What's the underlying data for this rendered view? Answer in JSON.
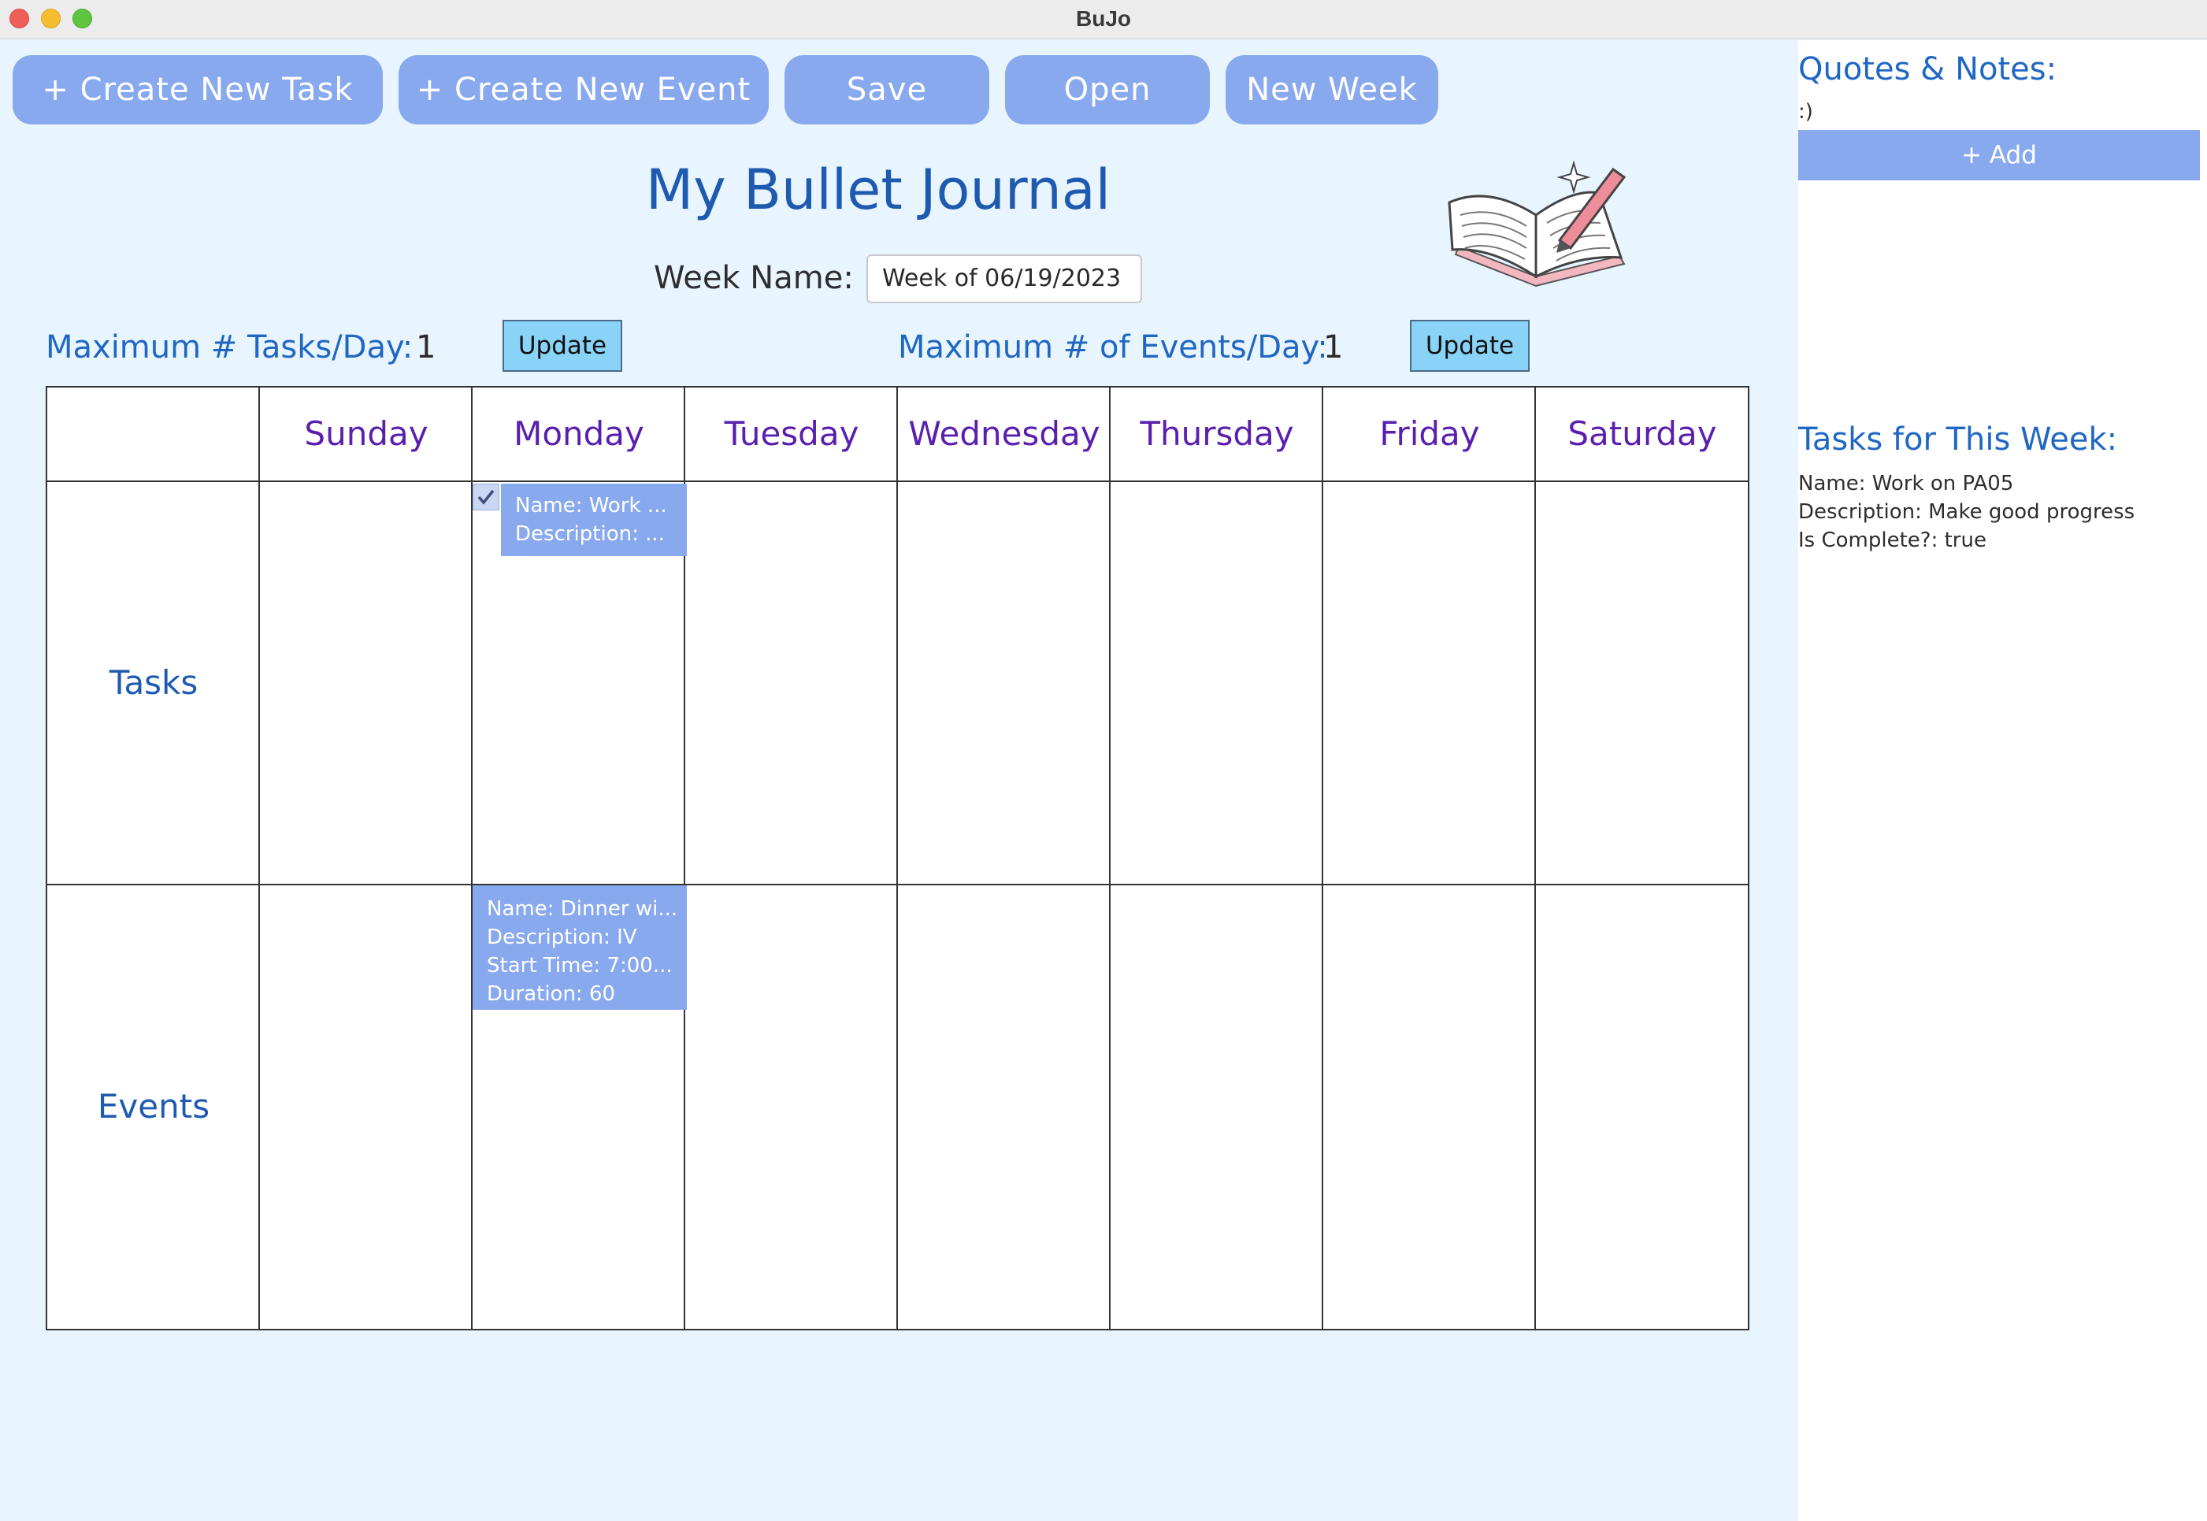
{
  "window": {
    "title": "BuJo"
  },
  "toolbar": {
    "create_task": "+ Create New Task",
    "create_event": "+ Create New Event",
    "save": "Save",
    "open": "Open",
    "new_week": "New Week"
  },
  "header": {
    "title": "My Bullet Journal",
    "week_name_label": "Week Name:",
    "week_name_value": "Week of 06/19/2023",
    "book_icon": "open-book-with-pen-icon"
  },
  "limits": {
    "max_tasks_label": "Maximum # Tasks/Day:",
    "max_tasks_value": "1",
    "max_events_label": "Maximum # of Events/Day:",
    "max_events_value": "1",
    "update_label": "Update"
  },
  "grid": {
    "days": [
      "Sunday",
      "Monday",
      "Tuesday",
      "Wednesday",
      "Thursday",
      "Friday",
      "Saturday"
    ],
    "rows": [
      "Tasks",
      "Events"
    ],
    "task_card": {
      "line1": "Name: Work ...",
      "line2": "Description: ...",
      "checked": true
    },
    "event_card": {
      "line1": "Name: Dinner wi...",
      "line2": "Description: IV",
      "line3": "Start Time: 7:00...",
      "line4": "Duration: 60"
    }
  },
  "sidebar": {
    "quotes_heading": "Quotes & Notes:",
    "quotes_text": ":)",
    "add_label": "+ Add",
    "tasks_heading": "Tasks for This Week:",
    "task_name": "Name: Work on PA05",
    "task_description": "Description: Make good progress",
    "task_complete": "Is Complete?: true"
  },
  "colors": {
    "background": "#e9f5fe",
    "button": "#89a9ef",
    "heading_blue": "#1e5bb0",
    "day_purple": "#5a1fae",
    "update_button": "#8ad3f8"
  }
}
